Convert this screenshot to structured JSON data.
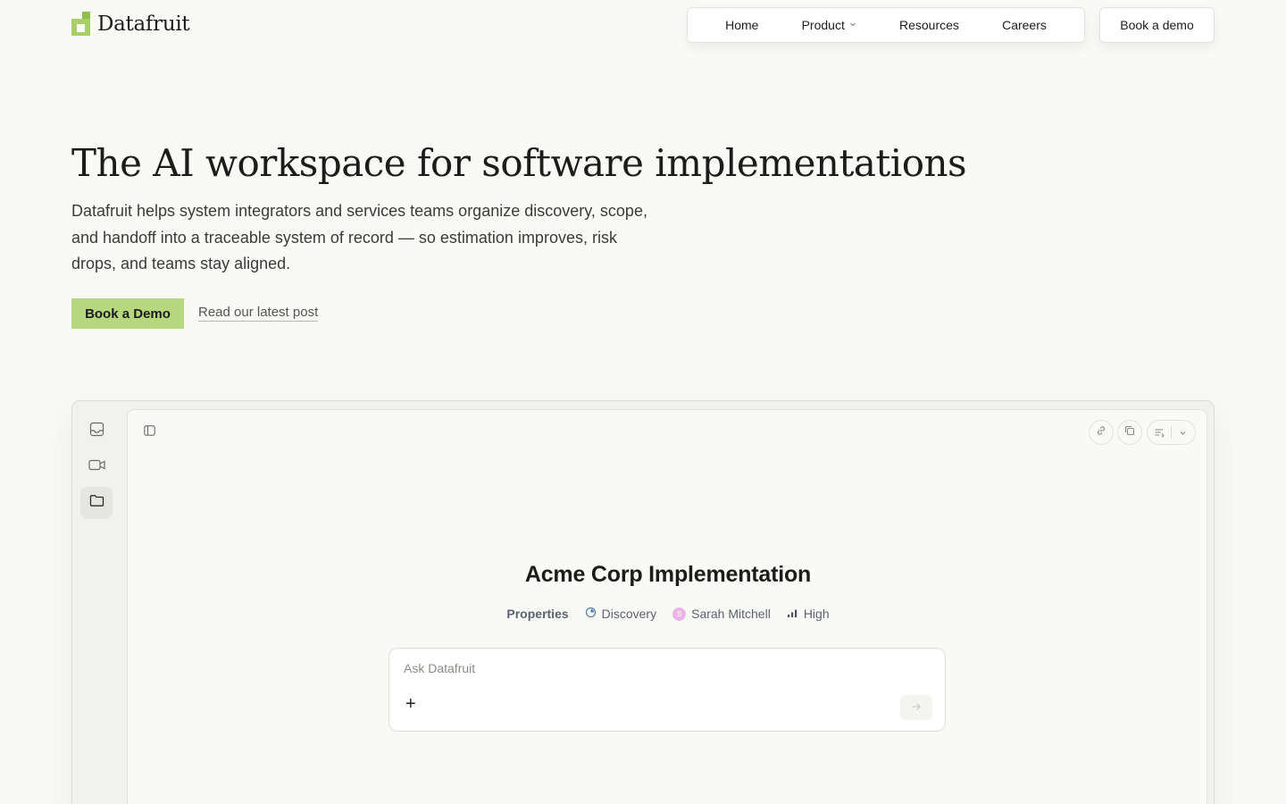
{
  "brand": {
    "name": "Datafruit"
  },
  "nav": {
    "items": [
      {
        "label": "Home"
      },
      {
        "label": "Product"
      },
      {
        "label": "Resources"
      },
      {
        "label": "Careers"
      }
    ],
    "demo_label": "Book a demo"
  },
  "hero": {
    "title": "The AI workspace for software implementations",
    "subtitle": "Datafruit helps system integrators and services teams organize discovery, scope, and handoff into a traceable system of record — so estimation improves, risk drops, and teams stay aligned.",
    "cta_primary": "Book a Demo",
    "cta_secondary": "Read our latest post"
  },
  "workspace": {
    "sidebar_icons": [
      "inbox-icon",
      "video-icon",
      "folder-icon"
    ],
    "active_sidebar": "folder-icon",
    "project": {
      "title": "Acme Corp Implementation",
      "properties_label": "Properties",
      "status": "Discovery",
      "owner": "Sarah Mitchell",
      "owner_initial": "S",
      "priority": "High"
    },
    "ask": {
      "placeholder": "Ask Datafruit",
      "value": "",
      "plus": "+"
    }
  },
  "colors": {
    "background": "#f9f9f6",
    "accent": "#b6d77d",
    "logo_green": "#a9cf6a",
    "avatar": "#e9b6e3"
  }
}
